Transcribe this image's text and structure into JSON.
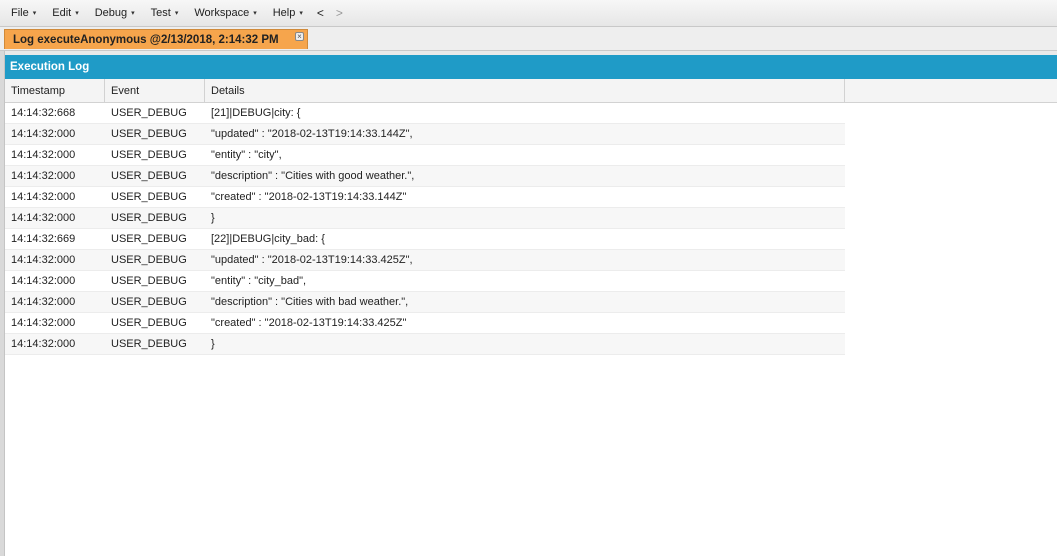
{
  "menu": {
    "items": [
      {
        "label": "File",
        "caret": "▾"
      },
      {
        "label": "Edit",
        "caret": "▾"
      },
      {
        "label": "Debug",
        "caret": "▾"
      },
      {
        "label": "Test",
        "caret": "▾"
      },
      {
        "label": "Workspace",
        "caret": "▾"
      },
      {
        "label": "Help",
        "caret": "▾"
      }
    ],
    "back": "<",
    "forward": ">"
  },
  "tab": {
    "title": "Log executeAnonymous @2/13/2018, 2:14:32 PM",
    "close": "×"
  },
  "panel": {
    "title": "Execution Log"
  },
  "grid": {
    "columns": [
      "Timestamp",
      "Event",
      "Details"
    ],
    "rows": [
      [
        "14:14:32:668",
        "USER_DEBUG",
        "[21]|DEBUG|city: {"
      ],
      [
        "14:14:32:000",
        "USER_DEBUG",
        "\"updated\" : \"2018-02-13T19:14:33.144Z\","
      ],
      [
        "14:14:32:000",
        "USER_DEBUG",
        "\"entity\" : \"city\","
      ],
      [
        "14:14:32:000",
        "USER_DEBUG",
        "\"description\" : \"Cities with good weather.\","
      ],
      [
        "14:14:32:000",
        "USER_DEBUG",
        "\"created\" : \"2018-02-13T19:14:33.144Z\""
      ],
      [
        "14:14:32:000",
        "USER_DEBUG",
        "}"
      ],
      [
        "14:14:32:669",
        "USER_DEBUG",
        "[22]|DEBUG|city_bad: {"
      ],
      [
        "14:14:32:000",
        "USER_DEBUG",
        "\"updated\" : \"2018-02-13T19:14:33.425Z\","
      ],
      [
        "14:14:32:000",
        "USER_DEBUG",
        "\"entity\" : \"city_bad\","
      ],
      [
        "14:14:32:000",
        "USER_DEBUG",
        "\"description\" : \"Cities with bad weather.\","
      ],
      [
        "14:14:32:000",
        "USER_DEBUG",
        "\"created\" : \"2018-02-13T19:14:33.425Z\""
      ],
      [
        "14:14:32:000",
        "USER_DEBUG",
        "}"
      ]
    ]
  },
  "colors": {
    "tab_active": "#f6a54c",
    "panel_header": "#1f9bc7"
  }
}
